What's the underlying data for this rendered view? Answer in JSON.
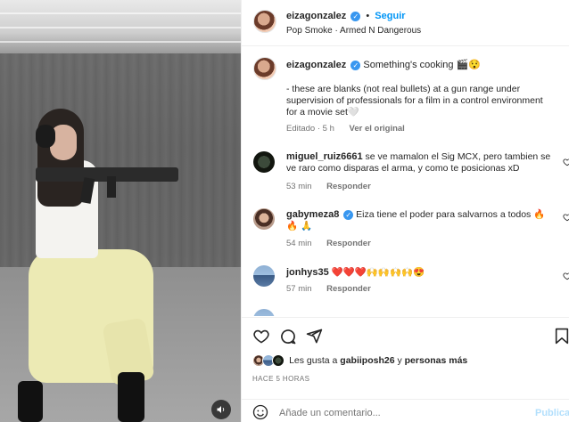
{
  "header": {
    "username": "eizagonzalez",
    "follow_separator": "•",
    "follow_label": "Seguir",
    "audio": "Pop Smoke · Armed N Dangerous"
  },
  "caption": {
    "username": "eizagonzalez",
    "title": "Something's cooking 🎬😯",
    "body": "- these are blanks (not real bullets) at a gun range under supervision of professionals for a film in a control environment for a movie set🤍",
    "edited": "Editado · 5 h",
    "see_original": "Ver el original"
  },
  "comments": [
    {
      "username": "miguel_ruiz6661",
      "text": "se ve mamalon el Sig MCX, pero tambien se ve raro como disparas el arma, y como te posicionas xD",
      "time": "53 min",
      "reply": "Responder"
    },
    {
      "username": "gabymeza8",
      "text": "Eiza tiene el poder para salvarnos a todos 🔥🔥 🙏",
      "time": "54 min",
      "reply": "Responder"
    },
    {
      "username": "jonhys35",
      "text": "❤️❤️❤️🙌🙌🙌🙌😍",
      "time": "57 min",
      "reply": "Responder"
    }
  ],
  "likes": {
    "prefix": "Les gusta a",
    "user": "gabiiposh26",
    "connector": "y",
    "others": "personas más"
  },
  "timestamp": "HACE 5 HORAS",
  "comment_input": {
    "placeholder": "Añade un comentario...",
    "publish": "Publicar"
  },
  "icons": {
    "like": "heart-icon",
    "comment": "comment-icon",
    "share": "share-icon",
    "save": "bookmark-icon",
    "emoji": "emoji-icon",
    "sound": "speaker-icon",
    "verified": "verified-badge-icon"
  },
  "colors": {
    "accent": "#0095f6",
    "publish_disabled": "#b2dffc",
    "verified": "#3897f0",
    "muted_text": "#737373"
  }
}
